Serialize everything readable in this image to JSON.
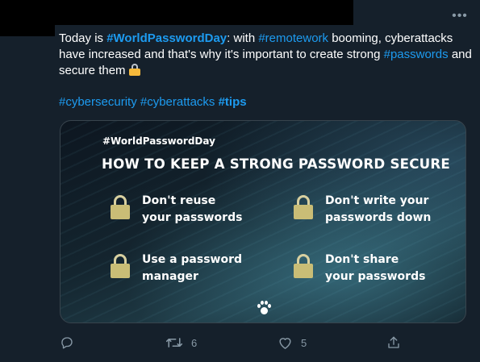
{
  "tweet": {
    "more_label": "•••",
    "text_parts": {
      "p1": "Today is ",
      "h1": "#WorldPasswordDay",
      "p2": ": with ",
      "h2": "#remotework",
      "p3": " booming, cyberattacks have increased and that's why it's important to create strong ",
      "h3": "#passwords",
      "p4": " and secure them "
    },
    "hashtags": {
      "h1": "#cybersecurity",
      "h2": "#cyberattacks",
      "h3": "#tips"
    }
  },
  "card": {
    "hashtag": "#WorldPasswordDay",
    "title": "HOW TO KEEP A STRONG PASSWORD SECURE",
    "tips": [
      {
        "line1": "Don't reuse",
        "line2": "your passwords"
      },
      {
        "line1": "Don't write your",
        "line2": "passwords down"
      },
      {
        "line1": "Use a password",
        "line2": "manager"
      },
      {
        "line1": "Don't share",
        "line2": "your passwords"
      }
    ]
  },
  "actions": {
    "reply_count": "",
    "retweet_count": "6",
    "like_count": "5"
  },
  "icons": [
    "more-icon",
    "lock-emoji-icon",
    "lock-icon",
    "paw-logo-icon",
    "reply-icon",
    "retweet-icon",
    "like-icon",
    "share-icon"
  ],
  "colors": {
    "background": "#15202b",
    "link": "#1d9bf0",
    "muted": "#8899a6"
  }
}
